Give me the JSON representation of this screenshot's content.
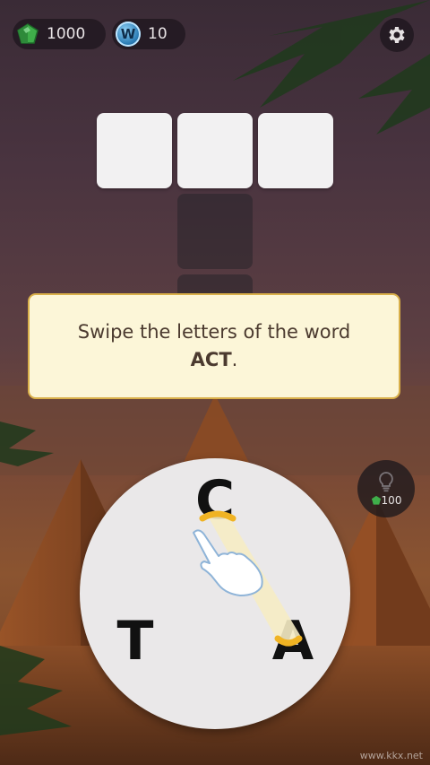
{
  "currency": {
    "gems": "1000",
    "words": "10",
    "words_badge": "W"
  },
  "tutorial": {
    "line1": "Swipe the letters of the word",
    "word": "ACT",
    "punct": "."
  },
  "hint": {
    "cost": "100"
  },
  "wheel": {
    "letters": [
      "C",
      "T",
      "A"
    ]
  },
  "watermark": "www.kkx.net",
  "colors": {
    "banner_bg": "#fcf6d8",
    "banner_border": "#d9b04a",
    "gem": "#3fae4a",
    "swipe_trail": "#f4e3a3"
  }
}
